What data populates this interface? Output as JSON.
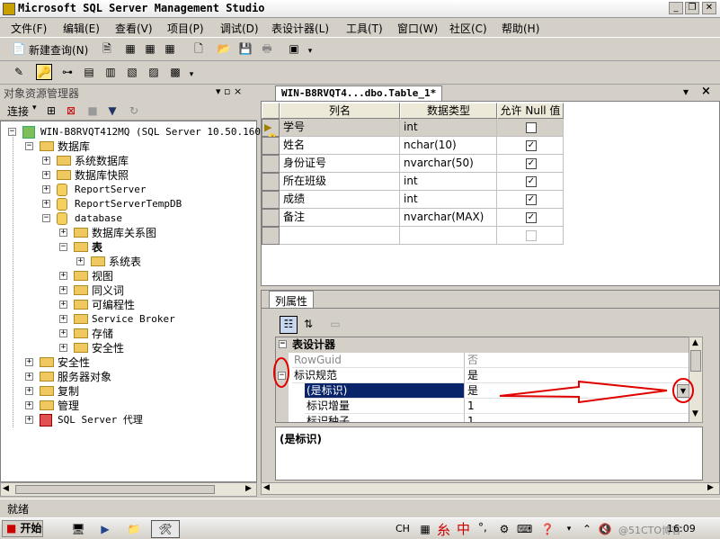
{
  "window": {
    "title": "Microsoft SQL Server Management Studio",
    "buttons": [
      "_",
      "❐",
      "✕"
    ]
  },
  "menu": [
    "文件(F)",
    "编辑(E)",
    "查看(V)",
    "项目(P)",
    "调试(D)",
    "表设计器(L)",
    "工具(T)",
    "窗口(W)",
    "社区(C)",
    "帮助(H)"
  ],
  "toolbar1": {
    "new_query": "新建查询(N)"
  },
  "object_explorer": {
    "title": "对象资源管理器",
    "connect": "连接",
    "pin": "▾ ▫ ×",
    "tree": [
      {
        "label": "WIN-B8RVQT412MQ (SQL Server 10.50.1600 -",
        "exp": "−",
        "icon": "server-icon"
      },
      {
        "label": "数据库",
        "exp": "−",
        "icon": "folder-icon"
      },
      {
        "label": "系统数据库",
        "exp": "+",
        "icon": "folder-icon"
      },
      {
        "label": "数据库快照",
        "exp": "+",
        "icon": "folder-icon"
      },
      {
        "label": "ReportServer",
        "exp": "+",
        "icon": "database-icon"
      },
      {
        "label": "ReportServerTempDB",
        "exp": "+",
        "icon": "database-icon"
      },
      {
        "label": "database",
        "exp": "−",
        "icon": "database-icon"
      },
      {
        "label": "数据库关系图",
        "exp": "+",
        "icon": "folder-icon"
      },
      {
        "label": "表",
        "exp": "−",
        "icon": "folder-icon"
      },
      {
        "label": "系统表",
        "exp": "+",
        "icon": "folder-icon"
      },
      {
        "label": "视图",
        "exp": "+",
        "icon": "folder-icon"
      },
      {
        "label": "同义词",
        "exp": "+",
        "icon": "folder-icon"
      },
      {
        "label": "可编程性",
        "exp": "+",
        "icon": "folder-icon"
      },
      {
        "label": "Service Broker",
        "exp": "+",
        "icon": "folder-icon"
      },
      {
        "label": "存储",
        "exp": "+",
        "icon": "folder-icon"
      },
      {
        "label": "安全性",
        "exp": "+",
        "icon": "folder-icon"
      },
      {
        "label": "安全性",
        "exp": "+",
        "icon": "folder-icon"
      },
      {
        "label": "服务器对象",
        "exp": "+",
        "icon": "folder-icon"
      },
      {
        "label": "复制",
        "exp": "+",
        "icon": "folder-icon"
      },
      {
        "label": "管理",
        "exp": "+",
        "icon": "folder-icon"
      },
      {
        "label": "SQL Server 代理",
        "exp": "+",
        "icon": "agent-icon"
      }
    ]
  },
  "designer": {
    "tab": "WIN-B8RVQT4...dbo.Table_1*",
    "headers": [
      "列名",
      "数据类型",
      "允许 Null 值"
    ],
    "rows": [
      {
        "name": "学号",
        "type": "int",
        "null": false
      },
      {
        "name": "姓名",
        "type": "nchar(10)",
        "null": true
      },
      {
        "name": "身份证号",
        "type": "nvarchar(50)",
        "null": true
      },
      {
        "name": "所在班级",
        "type": "int",
        "null": true
      },
      {
        "name": "成绩",
        "type": "int",
        "null": true
      },
      {
        "name": "备注",
        "type": "nvarchar(MAX)",
        "null": true
      },
      {
        "name": "",
        "type": "",
        "null": false
      }
    ]
  },
  "properties": {
    "tab": "列属性",
    "category": "表设计器",
    "rows": [
      {
        "name": "RowGuid",
        "value": "否"
      },
      {
        "name": "标识规范",
        "value": "是"
      },
      {
        "name": "(是标识)",
        "value": "是"
      },
      {
        "name": "标识增量",
        "value": "1"
      },
      {
        "name": "标识种子",
        "value": "1"
      }
    ],
    "description": "(是标识)"
  },
  "status": "就绪",
  "taskbar": {
    "start": "开始",
    "ime": "CH",
    "ime2": "中",
    "clock": "16:09",
    "watermark": "@51CTO博客"
  }
}
